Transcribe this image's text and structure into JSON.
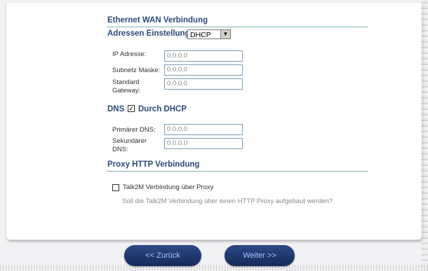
{
  "wan": {
    "title": "Ethernet WAN Verbindung",
    "address_setting_label": "Adressen Einstellung",
    "address_mode": "DHCP",
    "ip_label": "IP Adresse:",
    "ip_value": "0.0.0.0",
    "subnet_label": "Subnetz Maske:",
    "subnet_value": "0.0.0.0",
    "gateway_label_line1": "Standard",
    "gateway_label_line2": "Gateway:",
    "gateway_value": "0.0.0.0"
  },
  "dns": {
    "label": "DNS",
    "via_dhcp_label": "Durch DHCP",
    "via_dhcp_checked": true,
    "primary_label": "Primärer DNS:",
    "primary_value": "0.0.0.0",
    "secondary_label_line1": "Sekundärer",
    "secondary_label_line2": "DNS:",
    "secondary_value": "0.0.0.0"
  },
  "proxy": {
    "title": "Proxy HTTP Verbindung",
    "checkbox_label": "Talk2M Verbindung über Proxy",
    "checkbox_checked": false,
    "hint": "Soll die Talk2M Verbindung über einen HTTP Proxy aufgebaut werden?"
  },
  "nav": {
    "back_label": "<< Zurück",
    "next_label": "Weiter >>"
  },
  "colors": {
    "heading": "#2b4a7a",
    "section_rule": "#7fb0b0",
    "button_bg": "#1f3568",
    "button_text": "#9fc6ff"
  }
}
